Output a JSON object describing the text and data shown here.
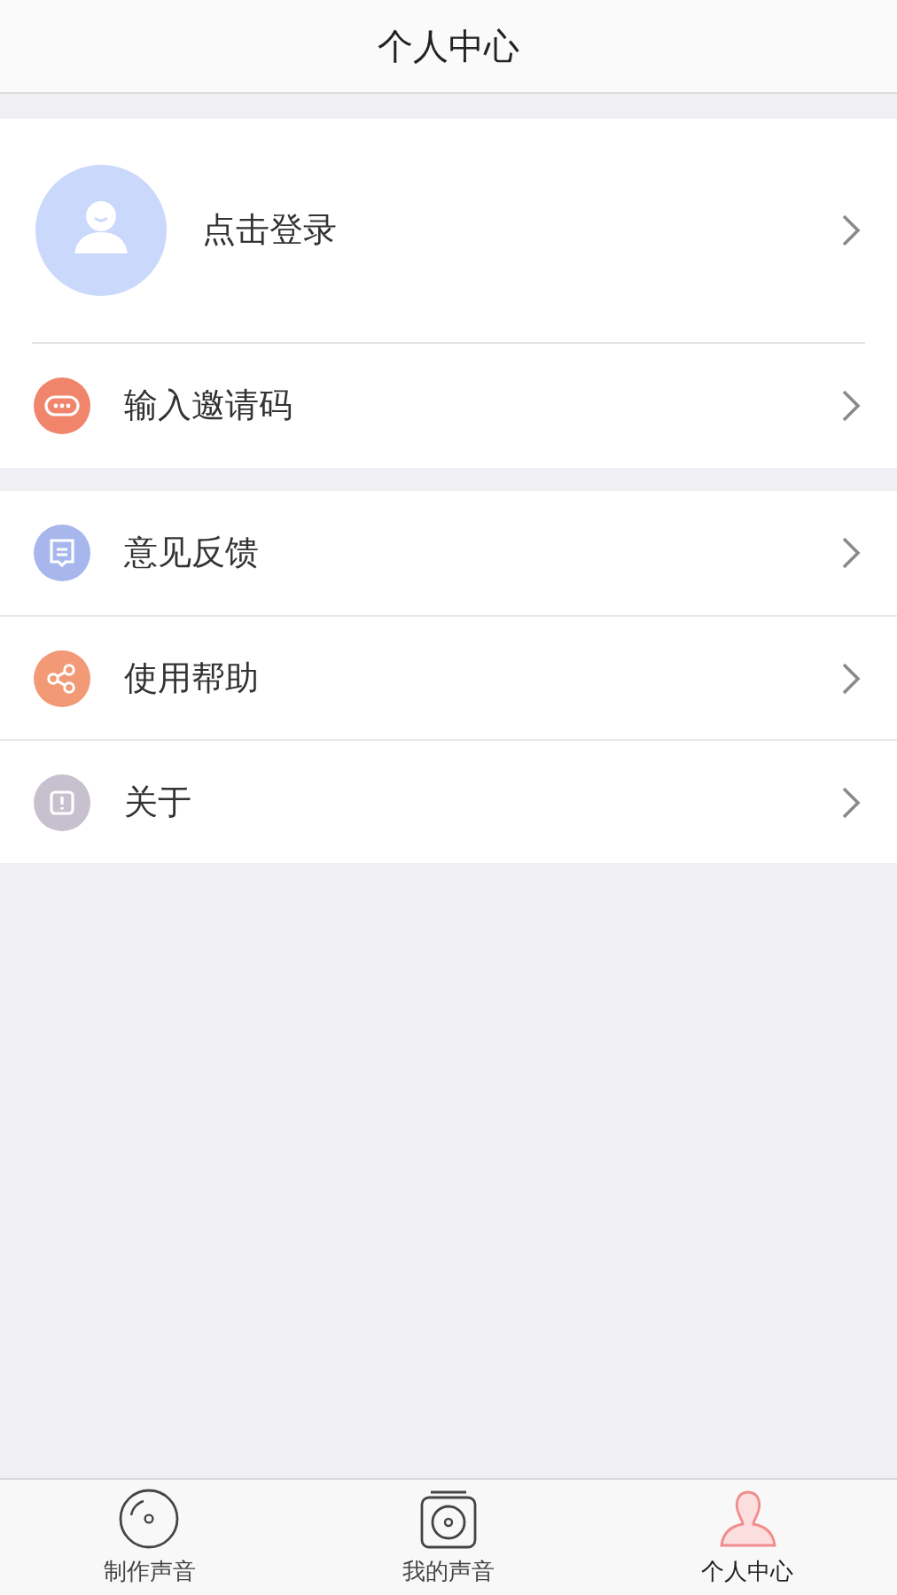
{
  "header": {
    "title": "个人中心"
  },
  "login": {
    "label": "点击登录"
  },
  "invite": {
    "label": "输入邀请码",
    "color": "#f0856c"
  },
  "menu": [
    {
      "label": "意见反馈",
      "color": "#a7b6ec"
    },
    {
      "label": "使用帮助",
      "color": "#f29a76"
    },
    {
      "label": "关于",
      "color": "#c6c0cf"
    }
  ],
  "tabs": [
    {
      "label": "制作声音",
      "selected": false
    },
    {
      "label": "我的声音",
      "selected": false
    },
    {
      "label": "个人中心",
      "selected": true
    }
  ]
}
